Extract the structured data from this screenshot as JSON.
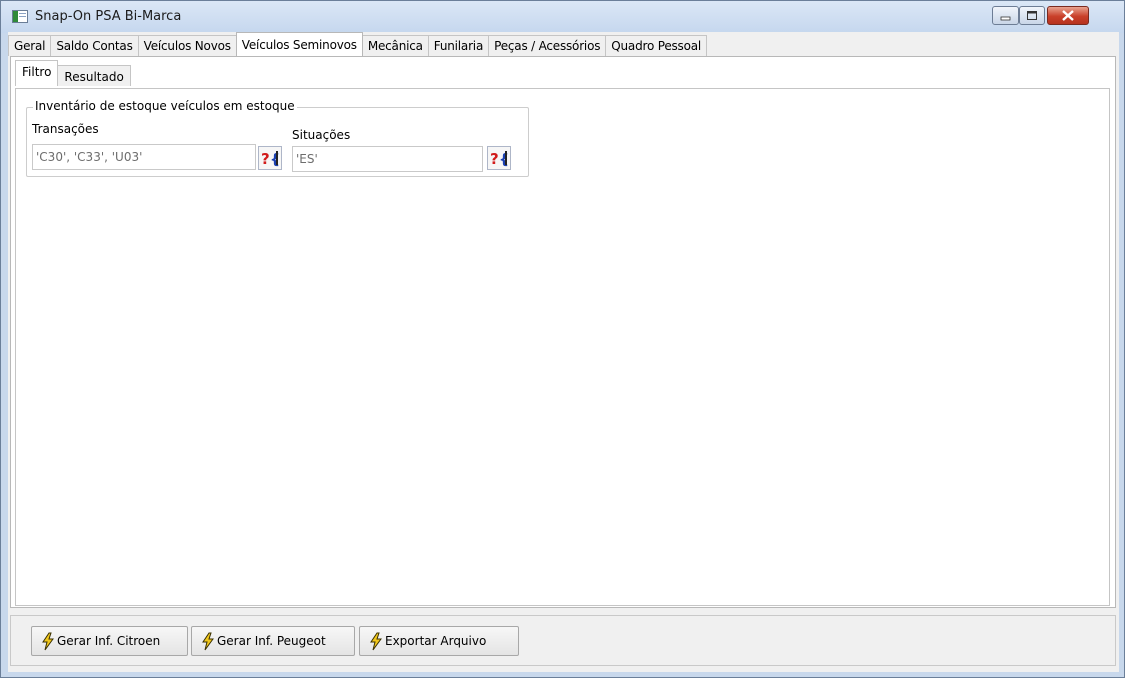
{
  "window": {
    "title": "Snap-On PSA Bi-Marca"
  },
  "tabs": [
    {
      "label": "Geral"
    },
    {
      "label": "Saldo Contas"
    },
    {
      "label": "Veículos Novos"
    },
    {
      "label": "Veículos Seminovos",
      "active": true
    },
    {
      "label": "Mecânica"
    },
    {
      "label": "Funilaria"
    },
    {
      "label": "Peças / Acessórios"
    },
    {
      "label": "Quadro Pessoal"
    }
  ],
  "subtabs": [
    {
      "label": "Filtro",
      "active": true
    },
    {
      "label": "Resultado"
    }
  ],
  "filter": {
    "group_title": "Inventário de estoque veículos em estoque",
    "transacoes": {
      "label": "Transações",
      "value": "'C30', 'C33', 'U03'"
    },
    "situacoes": {
      "label": "Situações",
      "value": "'ES'"
    }
  },
  "footer": {
    "citroen_label": "Gerar Inf. Citroen",
    "peugeot_label": "Gerar Inf. Peugeot",
    "export_label": "Exportar Arquivo"
  },
  "icons": {
    "app": "app-window-icon",
    "lookup": "lookup-icon",
    "action": "lightning-bolt-icon"
  },
  "colors": {
    "titlebar": "#c5d7ee",
    "close_button": "#c9402a",
    "bolt": "#f2c81c"
  }
}
